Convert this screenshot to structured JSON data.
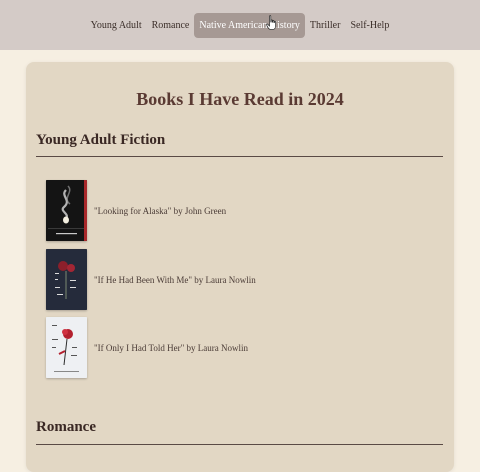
{
  "nav": {
    "items": [
      {
        "label": "Young Adult",
        "active": false
      },
      {
        "label": "Romance",
        "active": false
      },
      {
        "label": "Native American History",
        "active": true
      },
      {
        "label": "Thriller",
        "active": false
      },
      {
        "label": "Self-Help",
        "active": false
      }
    ]
  },
  "page": {
    "title": "Books I Have Read in 2024"
  },
  "sections": [
    {
      "title": "Young Adult Fiction",
      "books": [
        {
          "text": "\"Looking for Alaska\" by John Green",
          "cover": "looking-for-alaska-cover"
        },
        {
          "text": "\"If He Had Been With Me\" by Laura Nowlin",
          "cover": "if-he-had-been-with-me-cover"
        },
        {
          "text": "\"If Only I Had Told Her\" by Laura Nowlin",
          "cover": "if-only-i-had-told-her-cover"
        }
      ]
    },
    {
      "title": "Romance",
      "books": []
    }
  ],
  "colors": {
    "nav_bg": "#d4cbc7",
    "nav_active_bg": "#a69994",
    "page_bg": "#f6efe2",
    "card_bg": "#e2d7c4",
    "title_color": "#5a3a33"
  }
}
